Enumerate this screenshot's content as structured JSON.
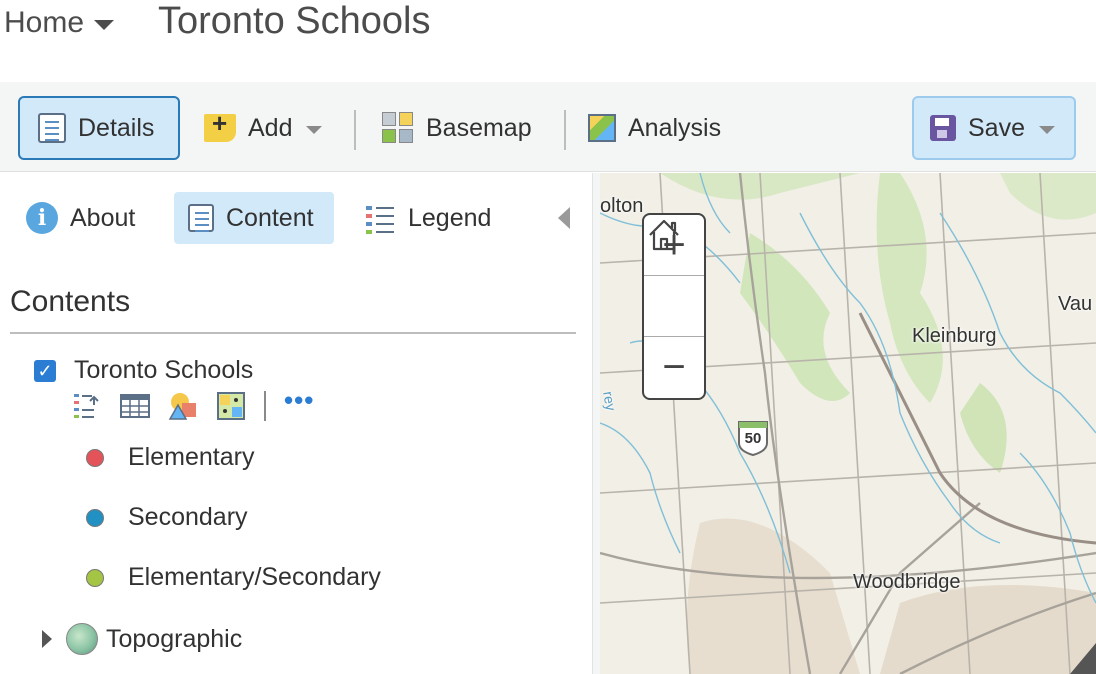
{
  "header": {
    "home_label": "Home",
    "title": "Toronto Schools"
  },
  "toolbar": {
    "details_label": "Details",
    "add_label": "Add",
    "basemap_label": "Basemap",
    "analysis_label": "Analysis",
    "save_label": "Save"
  },
  "panel": {
    "tabs": [
      {
        "label": "About",
        "icon": "info-icon"
      },
      {
        "label": "Content",
        "icon": "content-icon",
        "active": true
      },
      {
        "label": "Legend",
        "icon": "legend-icon"
      }
    ],
    "contents_heading": "Contents",
    "layer": {
      "name": "Toronto Schools",
      "checked": true,
      "tools": [
        "show-legend-icon",
        "table-icon",
        "change-style-icon",
        "perform-analysis-icon"
      ],
      "more_label": "•••"
    },
    "legend_items": [
      {
        "label": "Elementary",
        "color": "#e5535a"
      },
      {
        "label": "Secondary",
        "color": "#2191c4"
      },
      {
        "label": "Elementary/Secondary",
        "color": "#a4c544"
      }
    ],
    "basemap_layer": {
      "name": "Topographic"
    }
  },
  "map": {
    "labels": [
      "olton",
      "Kleinburg",
      "Vau",
      "Woodbridge",
      "rey"
    ],
    "route_shield": "50",
    "zoom_in": "+",
    "zoom_out": "−"
  },
  "colors": {
    "accent": "#2b7cd3",
    "active_bg": "#d2e9f9"
  }
}
